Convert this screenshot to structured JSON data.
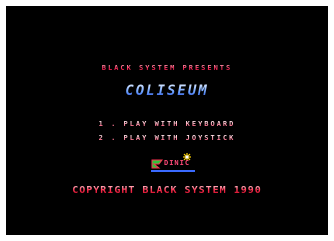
{
  "presents_text": "BLACK SYSTEM PRESENTS",
  "game_title": "COLISEUM",
  "menu": {
    "option_keyboard": "1 . PLAY WITH KEYBOARD",
    "option_joystick": "2 . PLAY WITH JOYSTICK"
  },
  "logo": {
    "icon": "dinic-logo-icon",
    "text": "DINIC"
  },
  "copyright_text": "COPYRIGHT BLACK SYSTEM 1990",
  "colors": {
    "background": "#000000",
    "presents": "#ff2a5a",
    "title": "#4a7cff",
    "menu": "#ff8aa8",
    "copyright": "#ff3050"
  }
}
